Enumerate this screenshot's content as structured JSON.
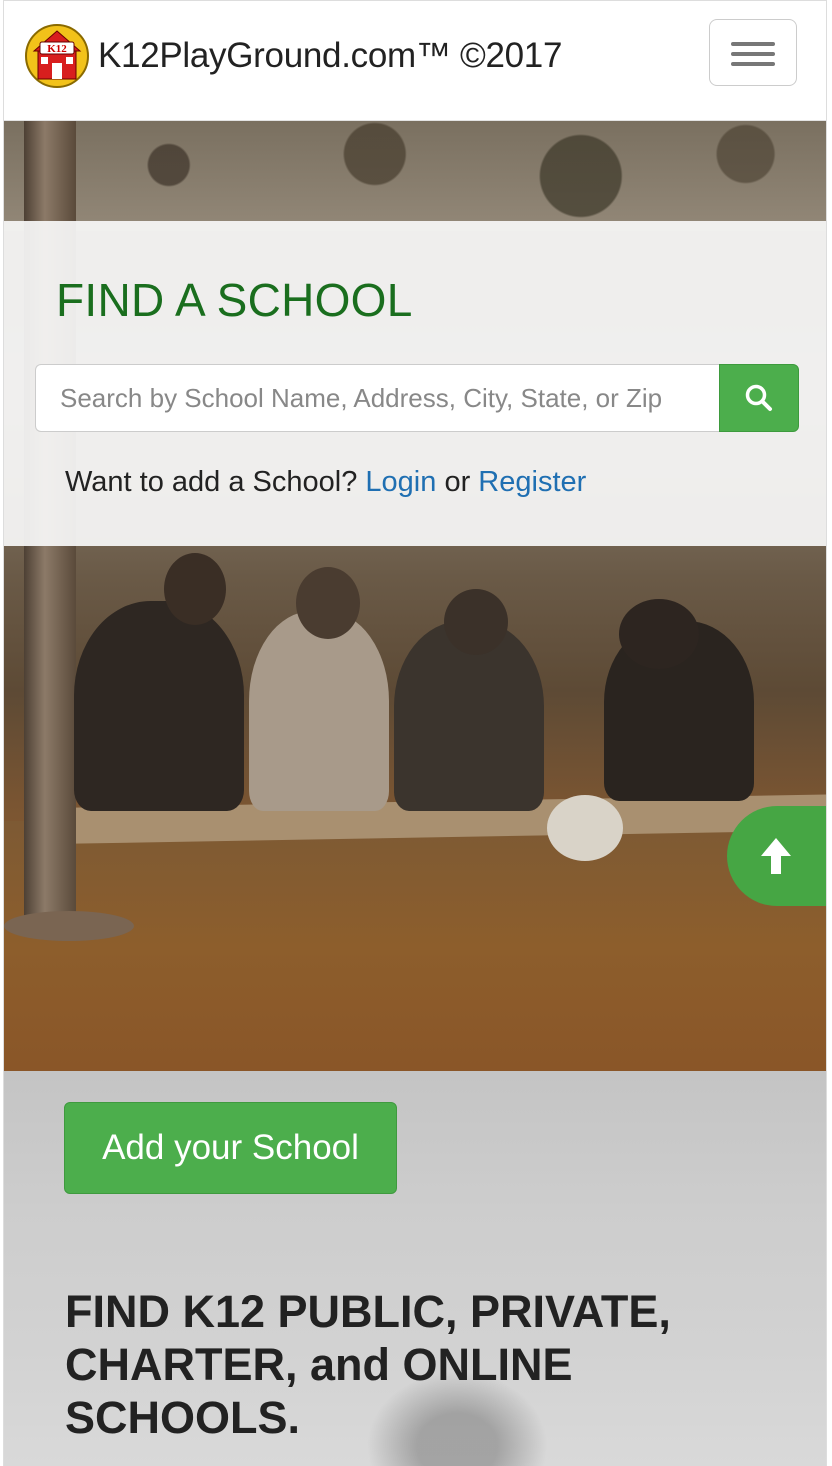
{
  "navbar": {
    "logo_text": "K12",
    "brand": "K12PlayGround.com™ ©2017",
    "menu_toggle_icon": "hamburger-icon"
  },
  "search_panel": {
    "title": "FIND A SCHOOL",
    "placeholder": "Search by School Name, Address, City, State, or Zip",
    "search_icon": "search-icon",
    "prompt": "Want to add a School?",
    "login_label": "Login",
    "or_text": "or",
    "register_label": "Register"
  },
  "back_to_top": {
    "icon": "arrow-up-icon"
  },
  "lower": {
    "add_button_label": "Add your School",
    "headline": "FIND K12 PUBLIC, PRIVATE, CHARTER, and ONLINE SCHOOLS."
  },
  "colors": {
    "accent_green": "#4cae4c",
    "title_green": "#1a6e1e",
    "link_blue": "#1f6fb2"
  }
}
